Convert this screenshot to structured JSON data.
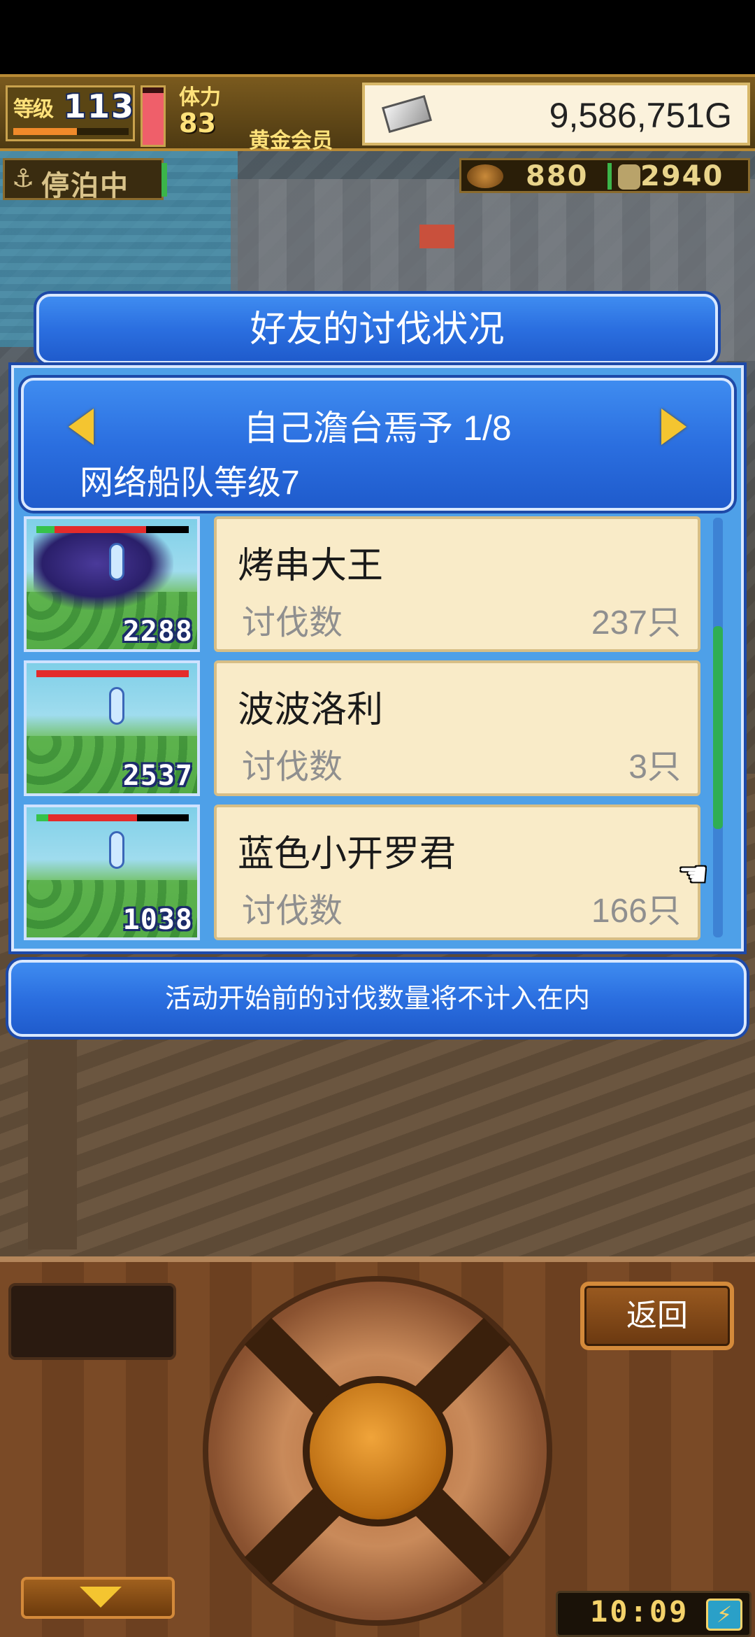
{
  "hud": {
    "level_label": "等级",
    "level_value": "113",
    "level_progress": 0.55,
    "hp_fraction": 0.9,
    "stamina_label": "体力",
    "stamina_value": "83",
    "member_label": "黄金会员",
    "gold": "9,586,751G",
    "dock_label": "停泊中",
    "resource_a": "880",
    "resource_b": "2940"
  },
  "dialog": {
    "title": "好友的讨伐状况",
    "player_name": "自己澹台焉予 1/8",
    "fleet_level": "网络船队等级7",
    "note": "活动开始前的讨伐数量将不计入在内",
    "scroll_position": 0.5,
    "friends": [
      {
        "name": "烤串大王",
        "kill_label": "讨伐数",
        "kill_value": "237只",
        "enemy_count": "2288",
        "enemy_hp_fraction": 0.72,
        "enemy_green_fraction": 0.12
      },
      {
        "name": "波波洛利",
        "kill_label": "讨伐数",
        "kill_value": "3只",
        "enemy_count": "2537",
        "enemy_hp_fraction": 1.0,
        "enemy_green_fraction": 0.0
      },
      {
        "name": "蓝色小开罗君",
        "kill_label": "讨伐数",
        "kill_value": "166只",
        "enemy_count": "1038",
        "enemy_hp_fraction": 0.66,
        "enemy_green_fraction": 0.08
      }
    ]
  },
  "panel": {
    "back_label": "返回",
    "clock": "10:09"
  },
  "icons": {
    "anchor": "⚓",
    "hand": "☚",
    "battery": "⚡"
  },
  "colors": {
    "banner_blue": "#2b6fe0",
    "card_bg": "#f9ebc8",
    "gold_text": "#ffe27a"
  }
}
